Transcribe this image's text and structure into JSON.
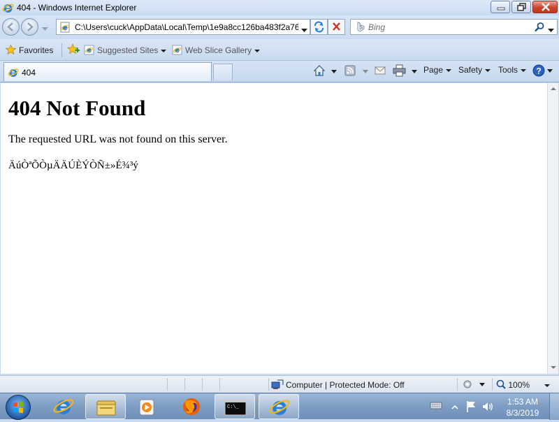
{
  "window": {
    "title": "404 - Windows Internet Explorer"
  },
  "navbar": {
    "address": "C:\\Users\\cuck\\AppData\\Local\\Temp\\1e9a8cc126ba483f2a76",
    "search_placeholder": "Bing"
  },
  "favbar": {
    "favorites": "Favorites",
    "suggested_sites": "Suggested Sites",
    "web_slice_gallery": "Web Slice Gallery"
  },
  "tabbar": {
    "tab_label": "404",
    "page": "Page",
    "safety": "Safety",
    "tools": "Tools"
  },
  "content": {
    "heading": "404 Not Found",
    "message": "The requested URL was not found on this server.",
    "garbled": "ÄúÒªÕÒµÄÄÚÈÝÒÑ±»É¾³ý"
  },
  "statusbar": {
    "zone": "Computer | Protected Mode: Off",
    "zoom": "100%"
  },
  "taskbar": {
    "time": "1:53 AM",
    "date": "8/3/2019"
  },
  "colors": {
    "chrome": "#c9daf0",
    "close_button": "#c9432c",
    "ie_blue": "#2a7fd4",
    "ie_ring": "#f2b61a"
  }
}
